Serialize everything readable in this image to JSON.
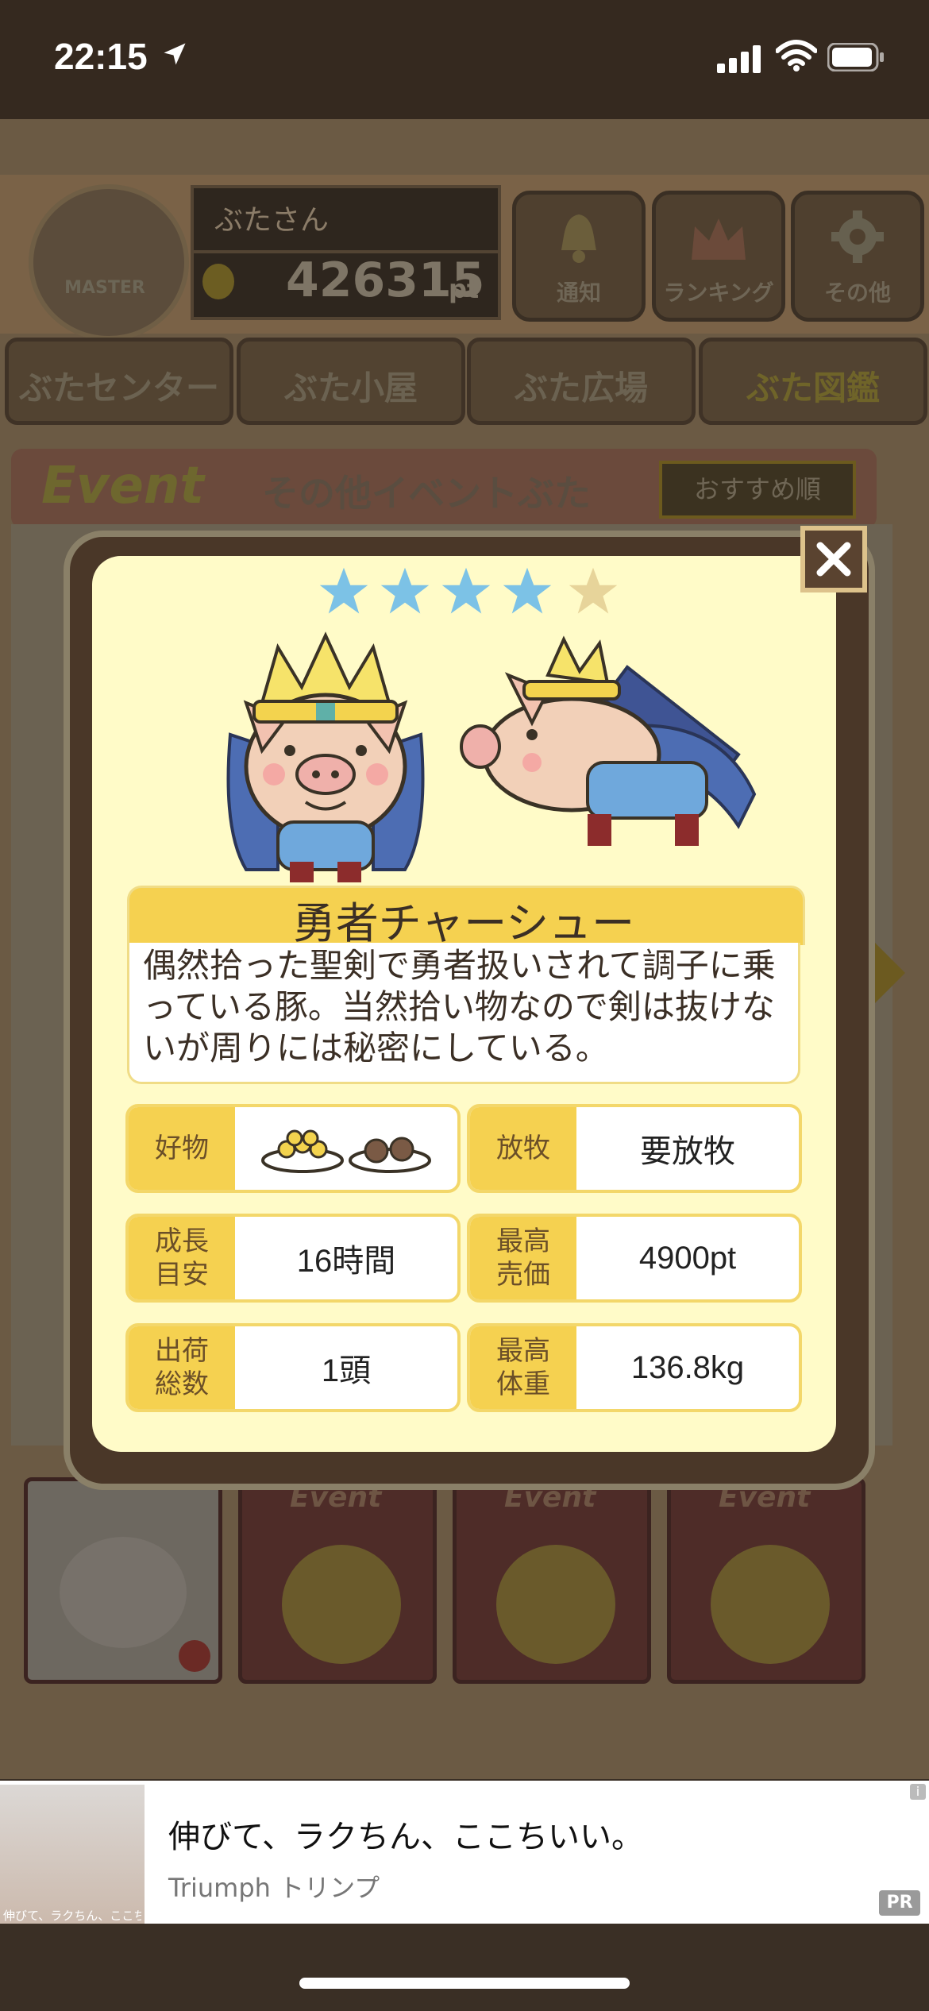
{
  "status_bar": {
    "time": "22:15"
  },
  "header": {
    "player_name": "ぶたさん",
    "points": "426315",
    "points_unit": "pt",
    "badge_text": "MASTER",
    "buttons": [
      {
        "label": "通知"
      },
      {
        "label": "ランキング"
      },
      {
        "label": "その他"
      }
    ]
  },
  "tabs": [
    {
      "label": "ぶたセンター"
    },
    {
      "label": "ぶた小屋"
    },
    {
      "label": "ぶた広場"
    },
    {
      "label": "ぶた図鑑"
    }
  ],
  "event_bar": {
    "event_word": "Event",
    "title": "その他イベントぶた",
    "sort_label": "おすすめ順"
  },
  "bottom_books": [
    {
      "label": ""
    },
    {
      "label": "Event"
    },
    {
      "label": "Event"
    },
    {
      "label": "Event"
    }
  ],
  "modal": {
    "stars_filled": 4,
    "stars_total": 5,
    "star_colors": {
      "filled": "#7cc2e6",
      "empty": "#e7d49a"
    },
    "pig_name": "勇者チャーシュー",
    "description": "偶然拾った聖剣で勇者扱いされて調子に乗っている豚。当然拾い物なので剣は抜けないが周りには秘密にしている。",
    "stats": [
      {
        "label": "好物",
        "value": ""
      },
      {
        "label": "放牧",
        "value": "要放牧"
      },
      {
        "label": "成長\n目安",
        "value": "16時間"
      },
      {
        "label": "最高\n売価",
        "value": "4900pt"
      },
      {
        "label": "出荷\n総数",
        "value": "1頭"
      },
      {
        "label": "最高\n体重",
        "value": "136.8kg"
      }
    ]
  },
  "ad": {
    "title": "伸びて、ラクちん、ここちいい。",
    "sponsor": "Triumph トリンプ",
    "pr_label": "PR",
    "info_label": "i",
    "image_caption": "伸びて、ラクちん、ここちいい。"
  }
}
